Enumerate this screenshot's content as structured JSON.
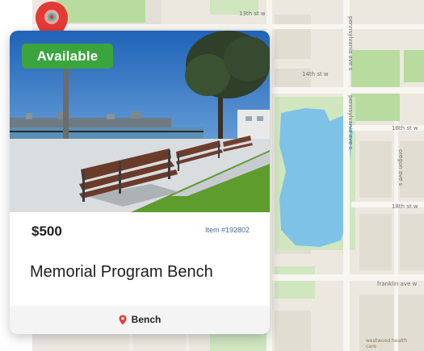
{
  "listing": {
    "status_badge": "Available",
    "price": "$500",
    "item_id": "Item #192802",
    "title": "Memorial Program Bench",
    "category": "Bench"
  },
  "map": {
    "street_labels": {
      "s13th": "13th st w",
      "s14th": "14th st w",
      "s16th": "16th st w",
      "s18th": "18th st w",
      "pennsylvania1": "pennsylvania ave s",
      "pennsylvania2": "pennsylvania ave s",
      "oregon": "oregon ave s",
      "franklin": "franklin ave w"
    },
    "poi_labels": {
      "westwood": "westwood health care"
    }
  },
  "colors": {
    "badge": "#3aa43d",
    "pin": "#e53935",
    "water": "#7fc2e8",
    "park": "#b8dca0"
  },
  "icons": {
    "map_pin": "map-pin-icon",
    "category_pin": "location-pin-icon"
  }
}
